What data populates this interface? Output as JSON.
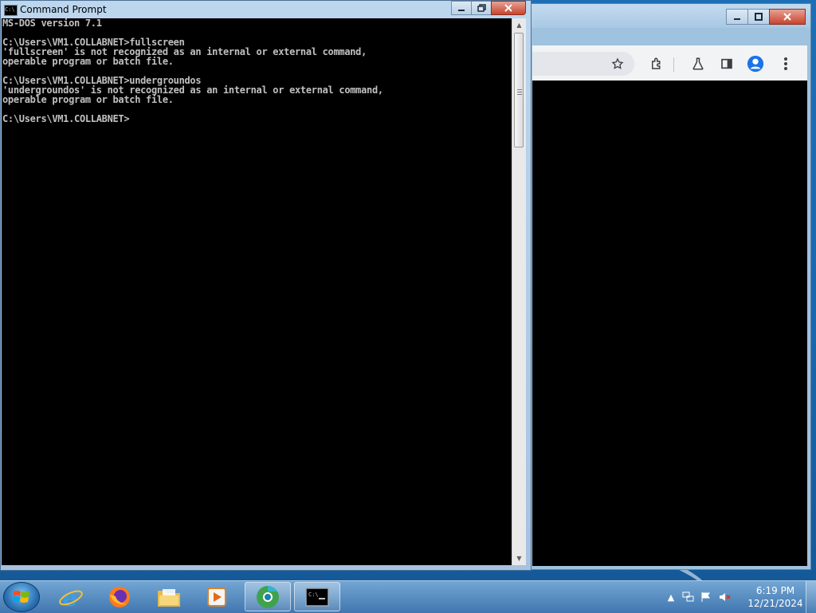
{
  "cmd_window": {
    "title": "Command Prompt",
    "icon_text": "C:\\",
    "lines": [
      "MS-DOS version 7.1",
      "",
      "C:\\Users\\VM1.COLLABNET>fullscreen",
      "'fullscreen' is not recognized as an internal or external command,",
      "operable program or batch file.",
      "",
      "C:\\Users\\VM1.COLLABNET>undergroundos",
      "'undergroundos' is not recognized as an internal or external command,",
      "operable program or batch file.",
      "",
      "C:\\Users\\VM1.COLLABNET>"
    ],
    "text_color": "#c0c0c0",
    "background": "#000000"
  },
  "chrome_window": {
    "toolbar_icons": [
      "star-icon",
      "extensions-icon",
      "labs-icon",
      "side-panel-icon",
      "profile-icon",
      "more-menu-icon"
    ]
  },
  "taskbar": {
    "pinned": [
      "internet-explorer-icon",
      "firefox-icon",
      "file-explorer-icon",
      "media-player-icon",
      "chrome-icon",
      "command-prompt-icon"
    ],
    "clock": {
      "time": "6:19 PM",
      "date": "12/21/2024"
    },
    "tray": [
      "show-hidden-icons",
      "network-icon",
      "action-center-flag-icon",
      "volume-muted-icon"
    ]
  }
}
